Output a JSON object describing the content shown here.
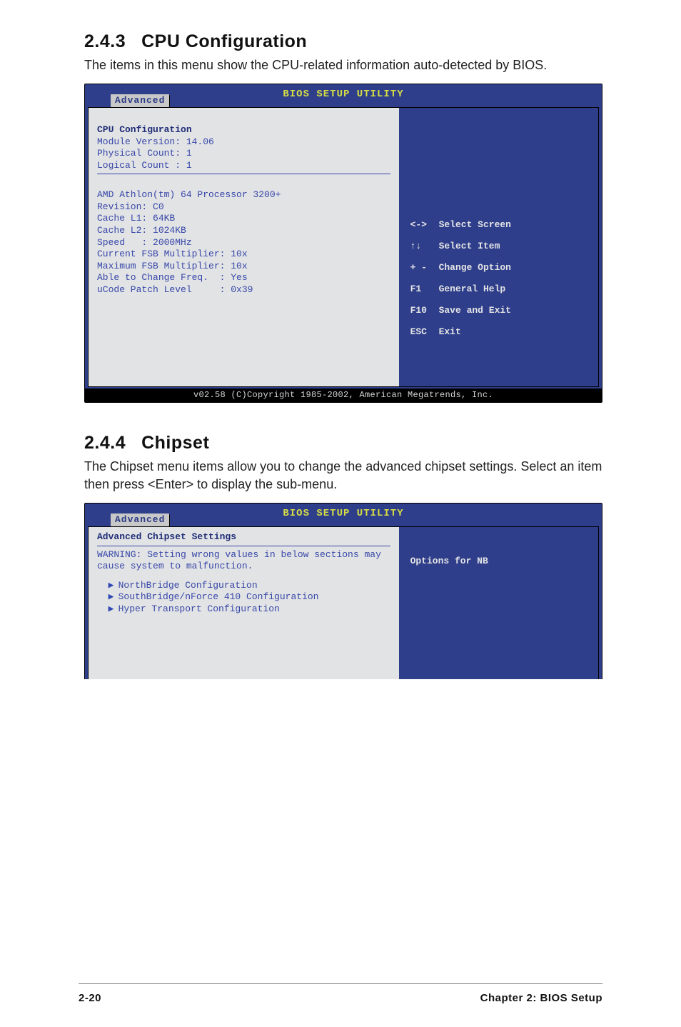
{
  "section1": {
    "number": "2.4.3",
    "title": "CPU Configuration",
    "intro": "The items in this menu show the CPU-related information auto-detected by BIOS."
  },
  "bios1": {
    "title": "BIOS SETUP UTILITY",
    "tab": "Advanced",
    "cpu_heading": "CPU Configuration",
    "module_version": "Module Version: 14.06",
    "physical_count": "Physical Count: 1",
    "logical_count": "Logical Count : 1",
    "cpu_name": "AMD Athlon(tm) 64 Processor 3200+",
    "revision": "Revision: C0",
    "cache_l1": "Cache L1: 64KB",
    "cache_l2": "Cache L2: 1024KB",
    "speed": "Speed   : 2000MHz",
    "cur_mult": "Current FSB Multiplier: 10x",
    "max_mult": "Maximum FSB Multiplier: 10x",
    "able_change": "Able to Change Freq.  : Yes",
    "ucode": "uCode Patch Level     : 0x39",
    "help": {
      "k1": "<->",
      "v1": "Select Screen",
      "k2": "↑↓",
      "v2": "Select Item",
      "k3": "+ -",
      "v3": "Change Option",
      "k4": "F1",
      "v4": "General Help",
      "k5": "F10",
      "v5": "Save and Exit",
      "k6": "ESC",
      "v6": "Exit"
    },
    "footer": "v02.58 (C)Copyright 1985-2002, American Megatrends, Inc."
  },
  "section2": {
    "number": "2.4.4",
    "title": "Chipset",
    "intro": "The Chipset menu items allow you to change the advanced chipset settings. Select an item then press <Enter> to display the sub-menu."
  },
  "bios2": {
    "title": "BIOS SETUP UTILITY",
    "tab": "Advanced",
    "heading": "Advanced Chipset Settings",
    "warning_l1": "WARNING: Setting wrong values in below sections may",
    "warning_l2": "cause system to malfunction.",
    "item1": "NorthBridge Configuration",
    "item2": "SouthBridge/nForce 410 Configuration",
    "item3": "Hyper Transport Configuration",
    "right_title": "Options for NB"
  },
  "footer": {
    "page": "2-20",
    "chapter": "Chapter 2: BIOS Setup"
  },
  "chart_data": {
    "type": "table",
    "title": "CPU Configuration (BIOS read-only info)",
    "rows": [
      {
        "field": "Module Version",
        "value": "14.06"
      },
      {
        "field": "Physical Count",
        "value": "1"
      },
      {
        "field": "Logical Count",
        "value": "1"
      },
      {
        "field": "Processor",
        "value": "AMD Athlon(tm) 64 Processor 3200+"
      },
      {
        "field": "Revision",
        "value": "C0"
      },
      {
        "field": "Cache L1",
        "value": "64KB"
      },
      {
        "field": "Cache L2",
        "value": "1024KB"
      },
      {
        "field": "Speed",
        "value": "2000MHz"
      },
      {
        "field": "Current FSB Multiplier",
        "value": "10x"
      },
      {
        "field": "Maximum FSB Multiplier",
        "value": "10x"
      },
      {
        "field": "Able to Change Freq.",
        "value": "Yes"
      },
      {
        "field": "uCode Patch Level",
        "value": "0x39"
      }
    ]
  }
}
